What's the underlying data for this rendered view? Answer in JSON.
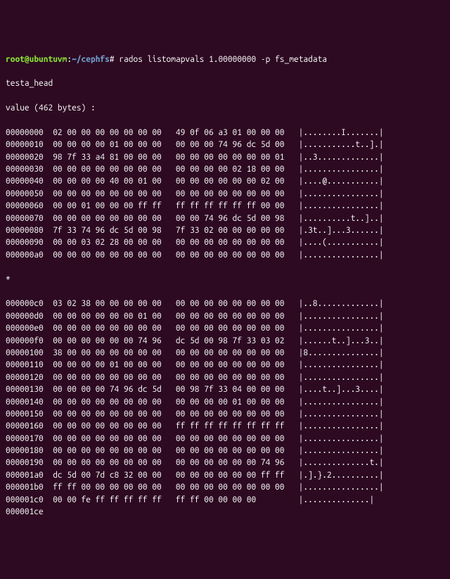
{
  "prompt": {
    "user": "root@ubuntuvm",
    "colon": ":",
    "path": "~/cephfs",
    "hash": "#",
    "command": " rados listomapvals 1.00000000 -p fs_metadata"
  },
  "header1": "testa_head",
  "header2": "value (462 bytes) :",
  "sep": "*",
  "rows": [
    {
      "o": "00000000",
      "h1": "02 00 00 00 00 00 00 00",
      "h2": "49 0f 06 a3 01 00 00 00",
      "a": "|........I.......|"
    },
    {
      "o": "00000010",
      "h1": "00 00 00 00 01 00 00 00",
      "h2": "00 00 00 74 96 dc 5d 00",
      "a": "|...........t..].|"
    },
    {
      "o": "00000020",
      "h1": "98 7f 33 a4 81 00 00 00",
      "h2": "00 00 00 00 00 00 00 01",
      "a": "|..3.............|"
    },
    {
      "o": "00000030",
      "h1": "00 00 00 00 00 00 00 00",
      "h2": "00 00 00 00 02 18 00 00",
      "a": "|................|"
    },
    {
      "o": "00000040",
      "h1": "00 00 00 00 40 00 01 00",
      "h2": "00 00 00 00 00 00 02 00",
      "a": "|....@...........|"
    },
    {
      "o": "00000050",
      "h1": "00 00 00 00 00 00 00 00",
      "h2": "00 00 00 00 00 00 00 00",
      "a": "|................|"
    },
    {
      "o": "00000060",
      "h1": "00 00 01 00 00 00 ff ff",
      "h2": "ff ff ff ff ff ff 00 00",
      "a": "|................|"
    },
    {
      "o": "00000070",
      "h1": "00 00 00 00 00 00 00 00",
      "h2": "00 00 74 96 dc 5d 00 98",
      "a": "|..........t..]..|"
    },
    {
      "o": "00000080",
      "h1": "7f 33 74 96 dc 5d 00 98",
      "h2": "7f 33 02 00 00 00 00 00",
      "a": "|.3t..]...3......|"
    },
    {
      "o": "00000090",
      "h1": "00 00 03 02 28 00 00 00",
      "h2": "00 00 00 00 00 00 00 00",
      "a": "|....(...........|"
    },
    {
      "o": "000000a0",
      "h1": "00 00 00 00 00 00 00 00",
      "h2": "00 00 00 00 00 00 00 00",
      "a": "|................|"
    }
  ],
  "rows2": [
    {
      "o": "000000c0",
      "h1": "03 02 38 00 00 00 00 00",
      "h2": "00 00 00 00 00 00 00 00",
      "a": "|..8.............|"
    },
    {
      "o": "000000d0",
      "h1": "00 00 00 00 00 00 01 00",
      "h2": "00 00 00 00 00 00 00 00",
      "a": "|................|"
    },
    {
      "o": "000000e0",
      "h1": "00 00 00 00 00 00 00 00",
      "h2": "00 00 00 00 00 00 00 00",
      "a": "|................|"
    },
    {
      "o": "000000f0",
      "h1": "00 00 00 00 00 00 74 96",
      "h2": "dc 5d 00 98 7f 33 03 02",
      "a": "|......t..]...3..|"
    },
    {
      "o": "00000100",
      "h1": "38 00 00 00 00 00 00 00",
      "h2": "00 00 00 00 00 00 00 00",
      "a": "|8...............|"
    },
    {
      "o": "00000110",
      "h1": "00 00 00 00 01 00 00 00",
      "h2": "00 00 00 00 00 00 00 00",
      "a": "|................|"
    },
    {
      "o": "00000120",
      "h1": "00 00 00 00 00 00 00 00",
      "h2": "00 00 00 00 00 00 00 00",
      "a": "|................|"
    },
    {
      "o": "00000130",
      "h1": "00 00 00 00 74 96 dc 5d",
      "h2": "00 98 7f 33 04 00 00 00",
      "a": "|....t..]...3....|"
    },
    {
      "o": "00000140",
      "h1": "00 00 00 00 00 00 00 00",
      "h2": "00 00 00 00 01 00 00 00",
      "a": "|................|"
    },
    {
      "o": "00000150",
      "h1": "00 00 00 00 00 00 00 00",
      "h2": "00 00 00 00 00 00 00 00",
      "a": "|................|"
    },
    {
      "o": "00000160",
      "h1": "00 00 00 00 00 00 00 00",
      "h2": "ff ff ff ff ff ff ff ff",
      "a": "|................|"
    },
    {
      "o": "00000170",
      "h1": "00 00 00 00 00 00 00 00",
      "h2": "00 00 00 00 00 00 00 00",
      "a": "|................|"
    },
    {
      "o": "00000180",
      "h1": "00 00 00 00 00 00 00 00",
      "h2": "00 00 00 00 00 00 00 00",
      "a": "|................|"
    },
    {
      "o": "00000190",
      "h1": "00 00 00 00 00 00 00 00",
      "h2": "00 00 00 00 00 00 74 96",
      "a": "|..............t.|"
    },
    {
      "o": "000001a0",
      "h1": "dc 5d 00 7d c8 32 00 00",
      "h2": "00 00 00 00 00 00 ff ff",
      "a": "|.].}.2..........|"
    },
    {
      "o": "000001b0",
      "h1": "ff ff 00 00 00 00 00 00",
      "h2": "00 00 00 00 00 00 00 00",
      "a": "|................|"
    },
    {
      "o": "000001c0",
      "h1": "00 00 fe ff ff ff ff ff",
      "h2": "ff ff 00 00 00 00",
      "a": "|..............|"
    },
    {
      "o": "000001ce",
      "h1": "",
      "h2": "",
      "a": ""
    }
  ]
}
